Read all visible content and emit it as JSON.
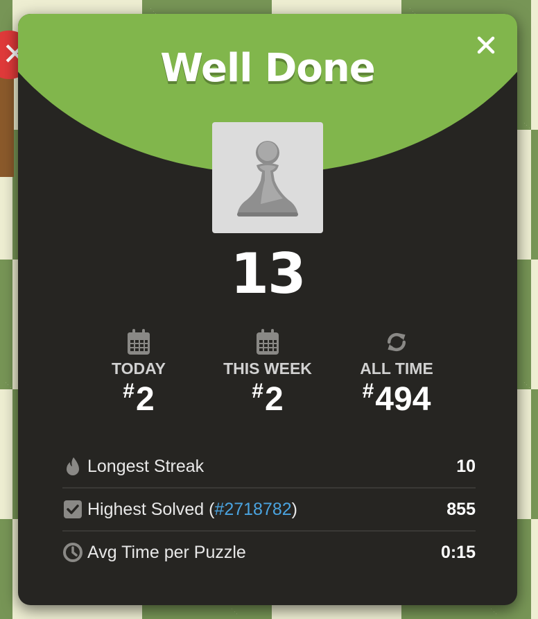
{
  "modal": {
    "title": "Well Done",
    "score": "13"
  },
  "ranks": [
    {
      "label": "TODAY",
      "hash": "#",
      "value": "2",
      "icon": "calendar-icon"
    },
    {
      "label": "THIS WEEK",
      "hash": "#",
      "value": "2",
      "icon": "calendar-icon"
    },
    {
      "label": "ALL TIME",
      "hash": "#",
      "value": "494",
      "icon": "refresh-icon"
    }
  ],
  "stats": {
    "longest_streak": {
      "label": "Longest Streak",
      "value": "10",
      "icon": "flame-icon"
    },
    "highest_solved": {
      "label_prefix": "Highest Solved (",
      "link": "#2718782",
      "label_suffix": ")",
      "value": "855",
      "icon": "checkbox-icon"
    },
    "avg_time": {
      "label": "Avg Time per Puzzle",
      "value": "0:15",
      "icon": "clock-icon"
    }
  },
  "colors": {
    "header_green": "#81b64c",
    "modal_bg": "#262522",
    "link": "#4aa3df",
    "board_light": "#eeeed2",
    "board_dark": "#779556"
  }
}
